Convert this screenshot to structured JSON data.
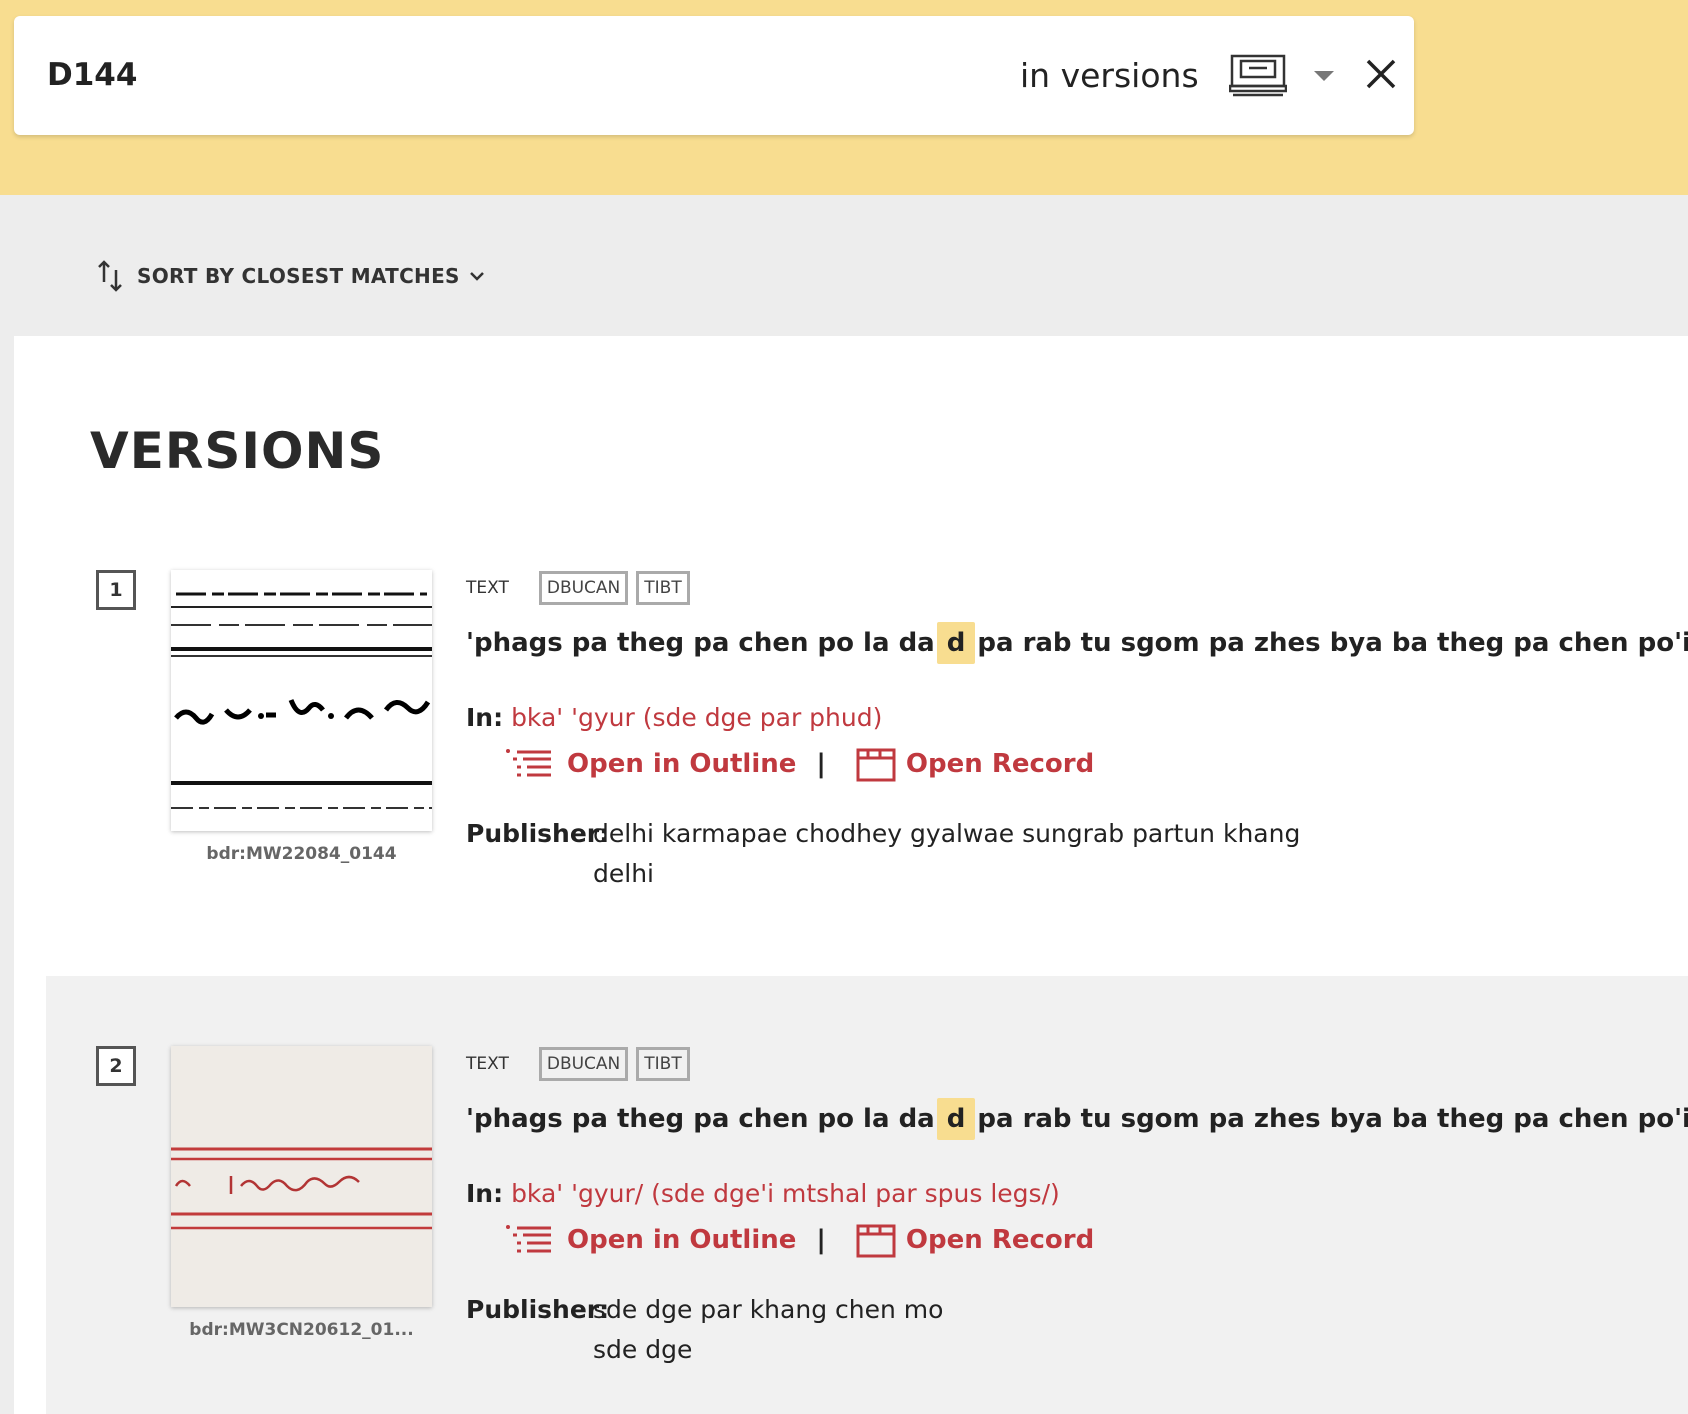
{
  "search": {
    "query": "D144",
    "scope_label": "in versions",
    "scope_icon": "printing-block-icon",
    "close_icon": "close-icon"
  },
  "toolbar": {
    "sort_label": "SORT BY CLOSEST MATCHES"
  },
  "section": {
    "title": "VERSIONS"
  },
  "results": [
    {
      "index": "1",
      "thumb_id": "bdr:MW22084_0144",
      "type": "TEXT",
      "tags": [
        "DBUCAN",
        "TIBT"
      ],
      "title_before": "'phags pa theg pa chen po la da",
      "title_highlight": "d",
      "title_after": "pa rab tu sgom pa zhes bya ba theg pa chen po'i mdo",
      "in_label": "In:",
      "in_value": "bka' 'gyur (sde dge par phud)",
      "outline_label": "Open in Outline",
      "separator": "|",
      "record_label": "Open Record",
      "publisher_label": "Publisher:",
      "publisher_name": "delhi karmapae chodhey gyalwae sungrab partun khang",
      "publisher_place": "delhi"
    },
    {
      "index": "2",
      "thumb_id": "bdr:MW3CN20612_01...",
      "type": "TEXT",
      "tags": [
        "DBUCAN",
        "TIBT"
      ],
      "title_before": "'phags pa theg pa chen po la da",
      "title_highlight": "d",
      "title_after": "pa rab tu sgom pa zhes bya ba theg pa chen po'i mdo",
      "in_label": "In:",
      "in_value": "bka' 'gyur/ (sde dge'i mtshal par spus legs/)",
      "outline_label": "Open in Outline",
      "separator": "|",
      "record_label": "Open Record",
      "publisher_label": "Publisher:",
      "publisher_name": "sde dge par khang chen mo",
      "publisher_place": "sde dge"
    }
  ],
  "colors": {
    "accent_yellow": "#f8dd90",
    "link_red": "#c0393f",
    "page_bg": "#ededed"
  }
}
